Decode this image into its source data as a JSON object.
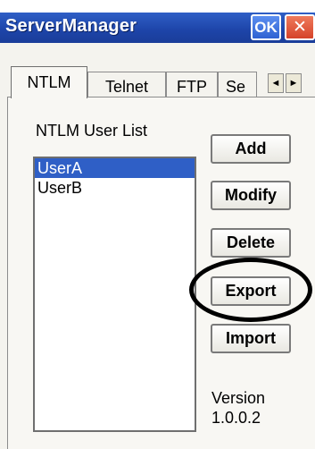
{
  "window": {
    "title": "ServerManager",
    "ok_label": "OK",
    "close_label": "✕"
  },
  "tabs": [
    {
      "label": "NTLM",
      "active": true
    },
    {
      "label": "Telnet",
      "active": false
    },
    {
      "label": "FTP",
      "active": false
    },
    {
      "label": "Se",
      "active": false
    }
  ],
  "tab_scroll": {
    "left_icon": "◄",
    "right_icon": "►"
  },
  "ntlm_panel": {
    "list_label": "NTLM User List",
    "users": [
      {
        "name": "UserA",
        "selected": true
      },
      {
        "name": "UserB",
        "selected": false
      }
    ],
    "buttons": {
      "add": "Add",
      "modify": "Modify",
      "delete": "Delete",
      "export": "Export",
      "import": "Import"
    },
    "version_label": "Version",
    "version_value": "1.0.0.2"
  },
  "colors": {
    "titlebar": "#1d44a8",
    "selection": "#2f5fc6",
    "close": "#d5432a"
  }
}
